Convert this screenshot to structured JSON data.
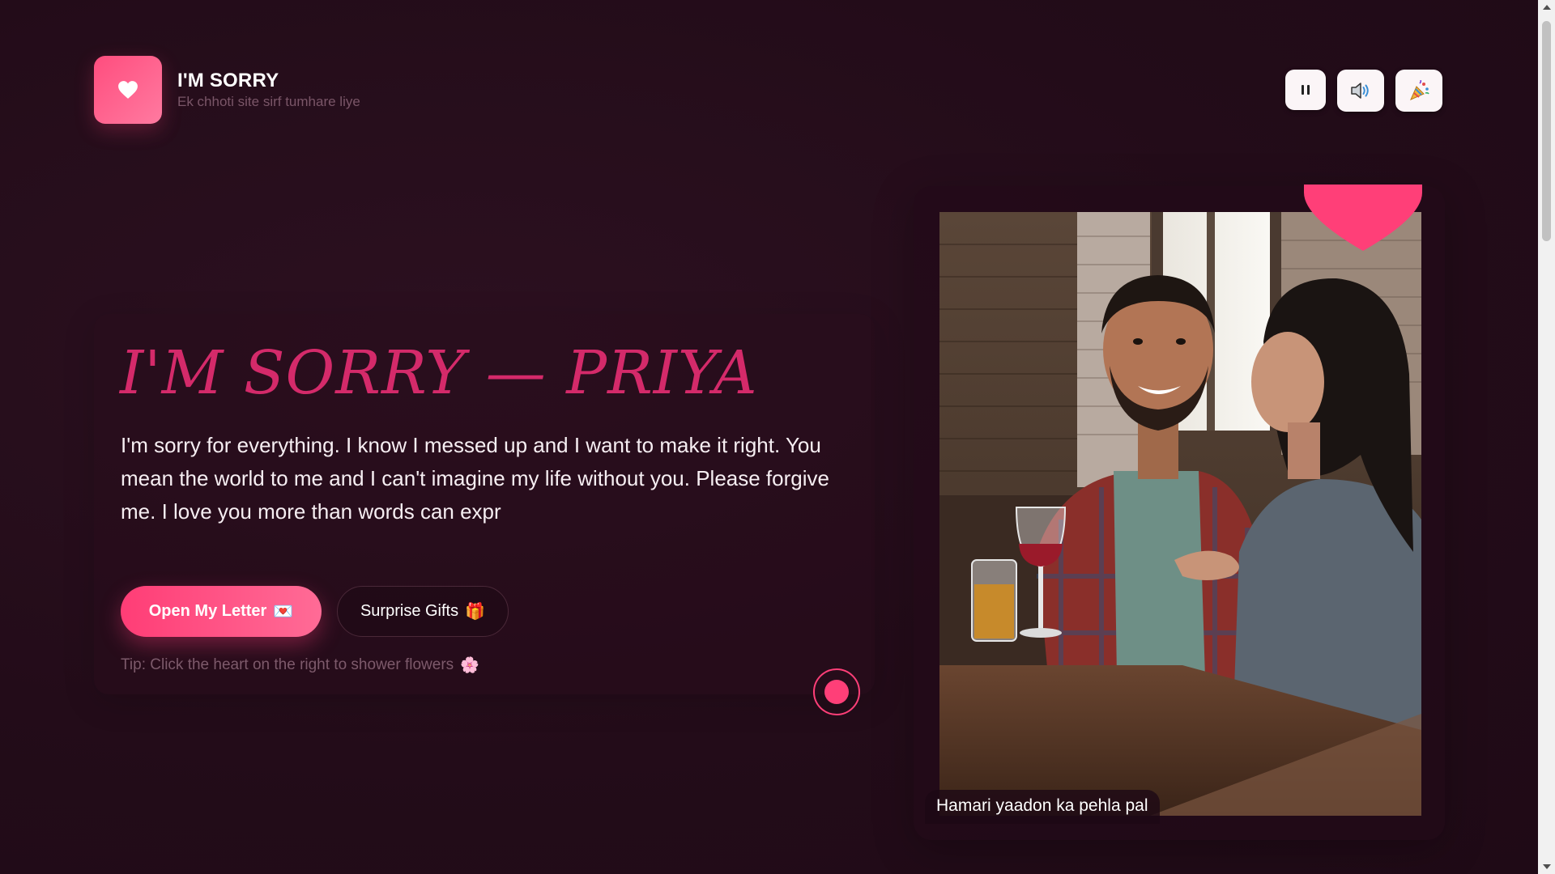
{
  "header": {
    "title": "I'M SORRY",
    "subtitle": "Ek chhoti site sirf tumhare liye",
    "logo_icon": "heart-icon",
    "controls": [
      {
        "name": "pause-button",
        "icon": "pause-icon",
        "glyph": "⏸"
      },
      {
        "name": "volume-button",
        "icon": "speaker-icon",
        "glyph": "🔊"
      },
      {
        "name": "confetti-button",
        "icon": "party-popper-icon",
        "glyph": "🎉"
      }
    ]
  },
  "hero": {
    "title": "I'M SORRY — PRIYA",
    "message": "I'm sorry for everything. I know I messed up and I want to make it right. You mean the world to me and I can't imagine my life without you. Please forgive me. I love you more than words can expr",
    "primary_button": "Open My Letter",
    "primary_emoji": "💌",
    "secondary_button": "Surprise Gifts",
    "secondary_emoji": "🎁",
    "tip": "Tip: Click the heart on the right to shower flowers",
    "tip_emoji": "🌸"
  },
  "photo": {
    "caption": "Hamari yaadon ka pehla pal"
  },
  "colors": {
    "background": "#240d1a",
    "accent": "#ff3f78",
    "title": "#d42a6a"
  }
}
